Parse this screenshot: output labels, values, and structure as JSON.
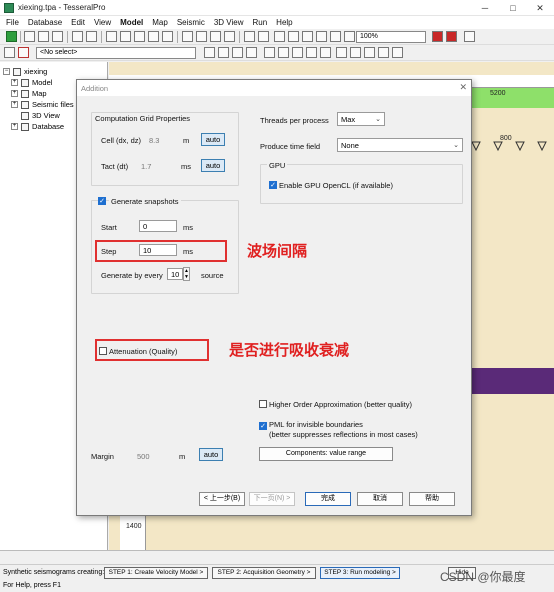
{
  "window": {
    "title": "xiexing.tpa - TesseralPro",
    "minimize_glyph": "─",
    "maximize_glyph": "□",
    "close_glyph": "✕"
  },
  "menu": [
    "File",
    "Database",
    "Edit",
    "View",
    "Model",
    "Map",
    "Seismic",
    "3D View",
    "Run",
    "Help"
  ],
  "toolbar": {
    "zoom_value": "100%",
    "select_value": "<No select>"
  },
  "tree": {
    "items": [
      "xiexing",
      "Model",
      "Map",
      "Seismic files",
      "3D View",
      "Database"
    ]
  },
  "background": {
    "ruler_top": "5200",
    "ruler_mid": "800",
    "ruler_left": "1400"
  },
  "dialog": {
    "title": "Addition",
    "close_glyph": "✕",
    "grid_group_label": "Computation Grid Properties",
    "cell_label": "Cell (dx, dz)",
    "cell_value": "8.3",
    "cell_unit": "m",
    "tact_label": "Tact (dt)",
    "tact_value": "1.7",
    "tact_unit": "ms",
    "auto_label": "auto",
    "threads_label": "Threads per process",
    "threads_value": "Max",
    "time_field_label": "Produce time field",
    "time_field_value": "None",
    "gpu_group_label": "GPU",
    "gpu_checkbox_label": "Enable GPU OpenCL (if available)",
    "snapshots_label": "Generate snapshots",
    "start_label": "Start",
    "start_value": "0",
    "start_unit": "ms",
    "step_label": "Step",
    "step_value": "10",
    "step_unit": "ms",
    "every_label": "Generate by every",
    "every_value": "10",
    "every_unit": "source",
    "attenuation_label": "Attenuation (Quality)",
    "higher_order_label": "Higher Order Approximation (better quality)",
    "pml_label_1": "PML for invisible boundaries",
    "pml_label_2": "(better suppresses reflections in most cases)",
    "margin_label": "Margin",
    "margin_value": "500",
    "margin_unit": "m",
    "components_button": "Components: value range",
    "back_button": "< 上一步(B)",
    "next_button": "下一页(N) >",
    "finish_button": "完成",
    "cancel_button": "取消",
    "help_button": "帮助"
  },
  "annotations": {
    "step_note": "波场间隔",
    "attenuation_note": "是否进行吸收衰减"
  },
  "steps": {
    "label": "Synthetic seismograms creating:",
    "step1": "STEP 1: Create Velocity Model >",
    "step2": "STEP 2: Acquisition Geometry >",
    "step3": "STEP 3: Run modeling >",
    "side_button": "Hide"
  },
  "status": {
    "text": "For Help, press F1",
    "watermark": "CSDN @你最度"
  }
}
